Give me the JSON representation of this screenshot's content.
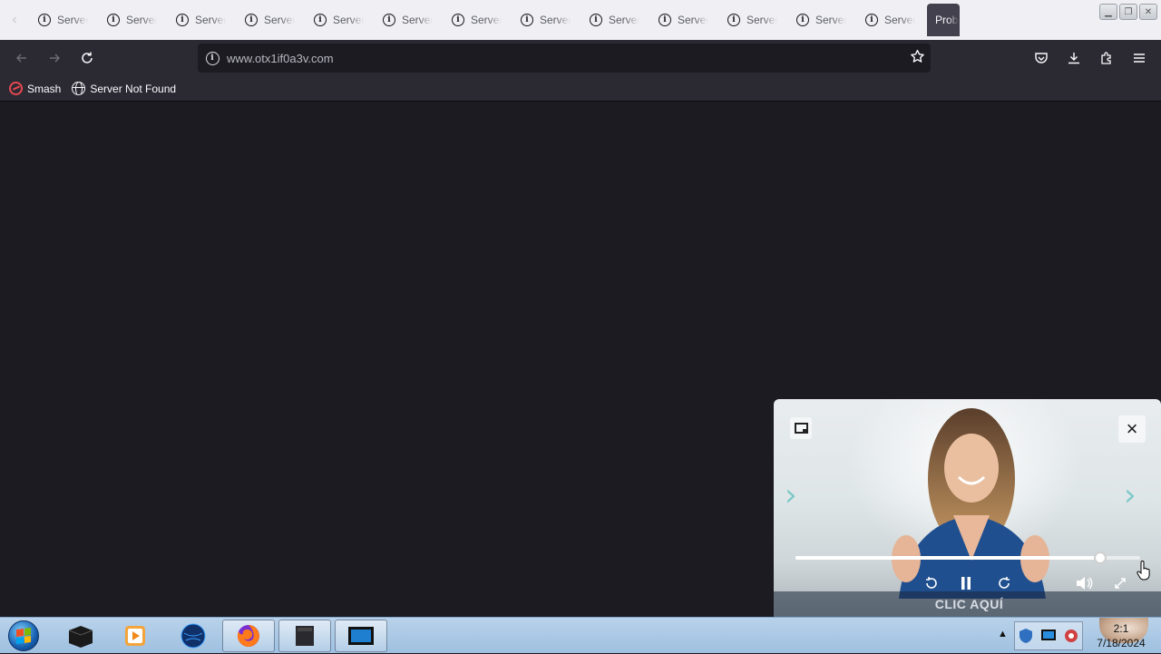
{
  "tabs": [
    {
      "label": "Server Not Found"
    },
    {
      "label": "Server Not Found"
    },
    {
      "label": "Server Not Found"
    },
    {
      "label": "Server Not Found"
    },
    {
      "label": "Server Not Found"
    },
    {
      "label": "Server Not Found"
    },
    {
      "label": "Server Not Found"
    },
    {
      "label": "Server Not Found"
    },
    {
      "label": "Server Not Found"
    },
    {
      "label": "Server Not Found"
    },
    {
      "label": "Server Not Found"
    },
    {
      "label": "Server Not Found"
    },
    {
      "label": "Server Not Found"
    }
  ],
  "active_tab": {
    "label": "Problem loading page"
  },
  "navbar": {
    "url": "www.otx1if0a3v.com"
  },
  "bookmarks": [
    {
      "label": "Smash",
      "icon": "smash-icon"
    },
    {
      "label": "Server Not Found",
      "icon": "globe-icon"
    }
  ],
  "video": {
    "banner_text": "CLIC AQUÍ",
    "progress": 0.885
  },
  "taskbar": {
    "time": "2:1",
    "date": "7/18/2024"
  },
  "colors": {
    "content_bg": "#1c1b22",
    "toolbar_bg": "#2b2a33",
    "tabstrip_bg": "#f0f0f4",
    "arrow_accent": "#7fc8c8"
  }
}
